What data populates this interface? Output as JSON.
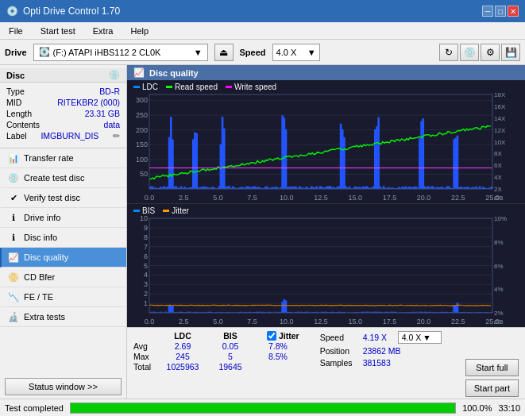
{
  "app": {
    "title": "Opti Drive Control 1.70",
    "icon": "💿"
  },
  "titlebar": {
    "minimize": "─",
    "maximize": "□",
    "close": "✕"
  },
  "menu": {
    "items": [
      "File",
      "Start test",
      "Extra",
      "Help"
    ]
  },
  "drive_bar": {
    "label": "Drive",
    "drive_value": "(F:) ATAPI iHBS112  2 CL0K",
    "speed_label": "Speed",
    "speed_value": "4.0 X"
  },
  "disc": {
    "header": "Disc",
    "type_label": "Type",
    "type_value": "BD-R",
    "mid_label": "MID",
    "mid_value": "RITEKBR2 (000)",
    "length_label": "Length",
    "length_value": "23.31 GB",
    "contents_label": "Contents",
    "contents_value": "data",
    "label_label": "Label",
    "label_value": "IMGBURN_DIS"
  },
  "nav_items": [
    {
      "id": "transfer-rate",
      "label": "Transfer rate",
      "active": false
    },
    {
      "id": "create-test-disc",
      "label": "Create test disc",
      "active": false
    },
    {
      "id": "verify-test-disc",
      "label": "Verify test disc",
      "active": false
    },
    {
      "id": "drive-info",
      "label": "Drive info",
      "active": false
    },
    {
      "id": "disc-info",
      "label": "Disc info",
      "active": false
    },
    {
      "id": "disc-quality",
      "label": "Disc quality",
      "active": true
    },
    {
      "id": "cd-bfer",
      "label": "CD Bfer",
      "active": false
    },
    {
      "id": "fe-te",
      "label": "FE / TE",
      "active": false
    },
    {
      "id": "extra-tests",
      "label": "Extra tests",
      "active": false
    }
  ],
  "status_window_btn": "Status window >>",
  "disc_quality": {
    "header": "Disc quality",
    "legend": {
      "ldc": "LDC",
      "read_speed": "Read speed",
      "write_speed": "Write speed",
      "bis": "BIS",
      "jitter": "Jitter"
    }
  },
  "stats": {
    "col_headers": [
      "LDC",
      "BIS"
    ],
    "rows": [
      {
        "label": "Avg",
        "ldc": "2.69",
        "bis": "0.05",
        "jitter": "7.8%"
      },
      {
        "label": "Max",
        "ldc": "245",
        "bis": "5",
        "jitter": "8.5%"
      },
      {
        "label": "Total",
        "ldc": "1025963",
        "bis": "19645",
        "jitter": ""
      }
    ],
    "jitter_label": "Jitter",
    "speed_label": "Speed",
    "speed_value": "4.19 X",
    "speed_dropdown": "4.0 X",
    "position_label": "Position",
    "position_value": "23862 MB",
    "samples_label": "Samples",
    "samples_value": "381583",
    "start_full": "Start full",
    "start_part": "Start part"
  },
  "status_bar": {
    "text": "Test completed",
    "progress": 100,
    "progress_text": "100.0%",
    "time": "33:10"
  }
}
